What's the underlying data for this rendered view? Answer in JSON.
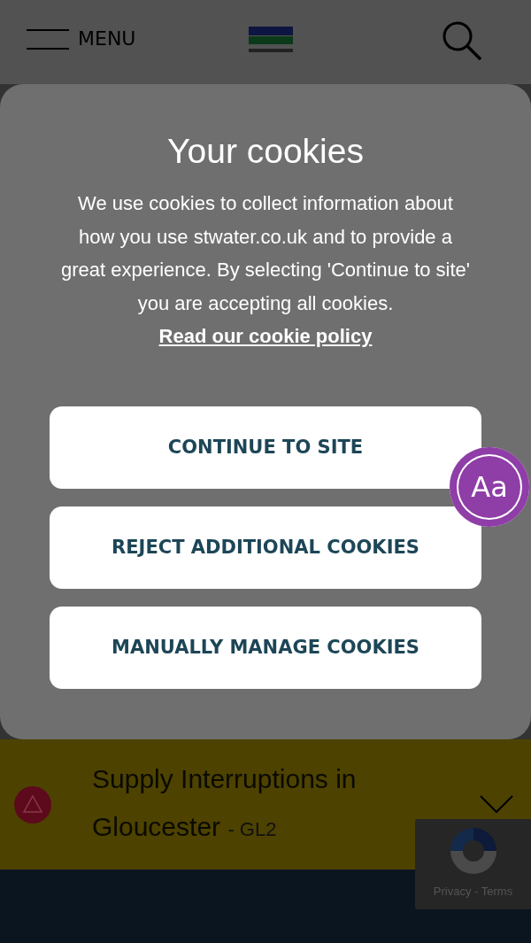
{
  "header": {
    "menu_label": "MENU"
  },
  "cookie_dialog": {
    "title": "Your cookies",
    "text": "We use cookies to collect information about how you use stwater.co.uk and to provide a great experience. By selecting 'Continue to site' you are accepting all cookies.",
    "link": "Read our cookie policy",
    "buttons": [
      "CONTINUE TO SITE",
      "REJECT ADDITIONAL COOKIES",
      "MANUALLY MANAGE COOKIES"
    ]
  },
  "accessibility_button": {
    "label": "Aa"
  },
  "alert_banner": {
    "title": "Supply Interruptions in Gloucester",
    "postcode": "- GL2",
    "expanded": false
  },
  "recaptcha": {
    "privacy": "Privacy",
    "separator": "-",
    "terms": "Terms"
  }
}
